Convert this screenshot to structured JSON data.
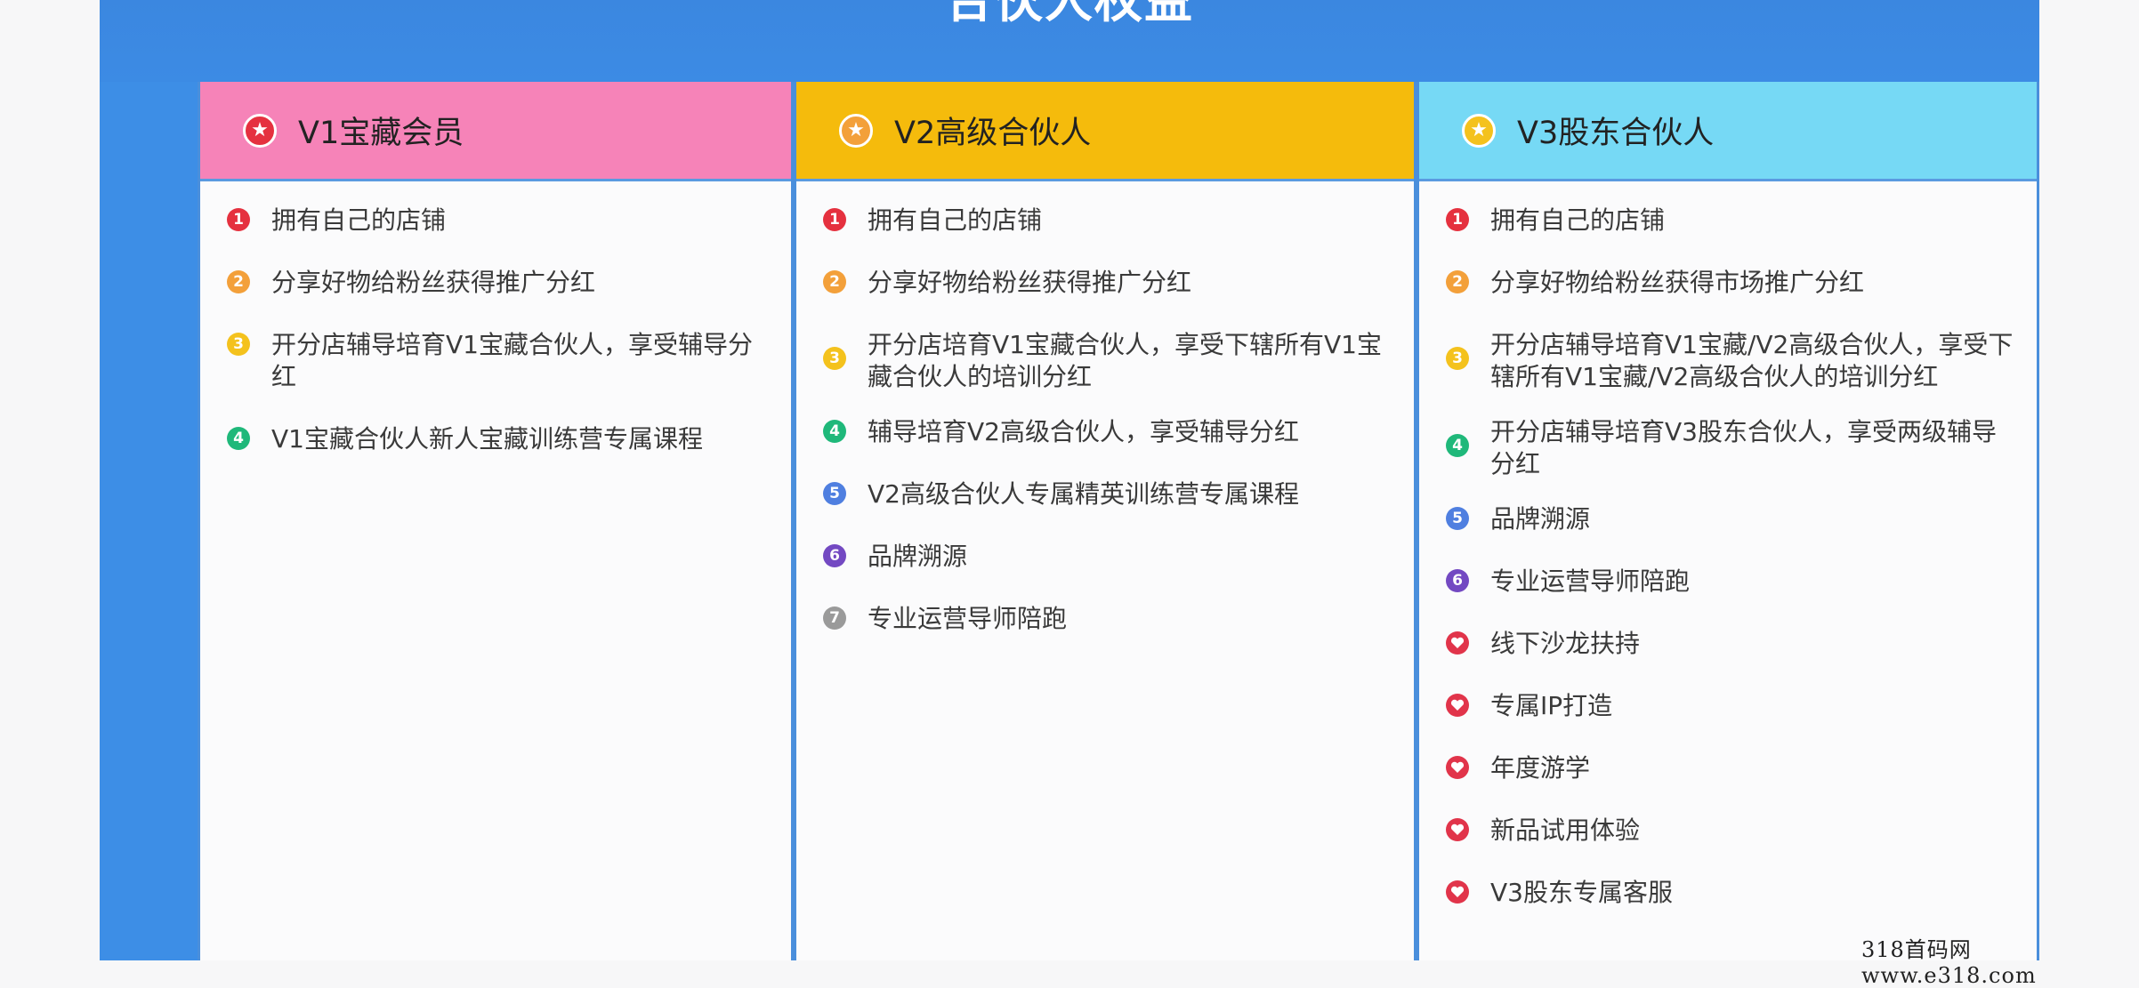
{
  "title": "合伙人权益",
  "colors": {
    "panel_blue": "#3d8ee6",
    "v1_header": "#f683b8",
    "v2_header": "#f5bb0c",
    "v3_header": "#76d9f5",
    "num1": "#e5313f",
    "num2": "#f3a03a",
    "num3": "#f4c21d",
    "num4": "#1fb87a",
    "num5": "#4f7fe0",
    "num6": "#7349c2",
    "num7": "#9a9a9a",
    "heart": "#e1344a"
  },
  "tiers": [
    {
      "label": "V1宝藏会员",
      "icon": "star-icon",
      "items": [
        {
          "n": "1",
          "text": "拥有自己的店铺"
        },
        {
          "n": "2",
          "text": "分享好物给粉丝获得推广分红"
        },
        {
          "n": "3",
          "text": "开分店辅导培育V1宝藏合伙人，享受辅导分红"
        },
        {
          "n": "4",
          "text": "V1宝藏合伙人新人宝藏训练营专属课程"
        }
      ]
    },
    {
      "label": "V2高级合伙人",
      "icon": "star-icon",
      "items": [
        {
          "n": "1",
          "text": "拥有自己的店铺"
        },
        {
          "n": "2",
          "text": "分享好物给粉丝获得推广分红"
        },
        {
          "n": "3",
          "text": "开分店培育V1宝藏合伙人，享受下辖所有V1宝藏合伙人的培训分红"
        },
        {
          "n": "4",
          "text": "辅导培育V2高级合伙人，享受辅导分红"
        },
        {
          "n": "5",
          "text": "V2高级合伙人专属精英训练营专属课程"
        },
        {
          "n": "6",
          "text": "品牌溯源"
        },
        {
          "n": "7",
          "text": "专业运营导师陪跑"
        }
      ]
    },
    {
      "label": "V3股东合伙人",
      "icon": "star-icon",
      "items": [
        {
          "n": "1",
          "text": "拥有自己的店铺"
        },
        {
          "n": "2",
          "text": "分享好物给粉丝获得市场推广分红"
        },
        {
          "n": "3",
          "text": "开分店辅导培育V1宝藏/V2高级合伙人，享受下辖所有V1宝藏/V2高级合伙人的培训分红"
        },
        {
          "n": "4",
          "text": "开分店辅导培育V3股东合伙人，享受两级辅导分红"
        },
        {
          "n": "5",
          "text": "品牌溯源"
        },
        {
          "n": "6",
          "text": "专业运营导师陪跑"
        },
        {
          "n": "",
          "text": "线下沙龙扶持",
          "icon": "heart-icon"
        },
        {
          "n": "",
          "text": "专属IP打造",
          "icon": "heart-icon"
        },
        {
          "n": "",
          "text": "年度游学",
          "icon": "heart-icon"
        },
        {
          "n": "",
          "text": "新品试用体验",
          "icon": "heart-icon"
        },
        {
          "n": "",
          "text": "V3股东专属客服",
          "icon": "heart-icon"
        }
      ]
    }
  ],
  "watermark": "318首码网  www.e318.com"
}
